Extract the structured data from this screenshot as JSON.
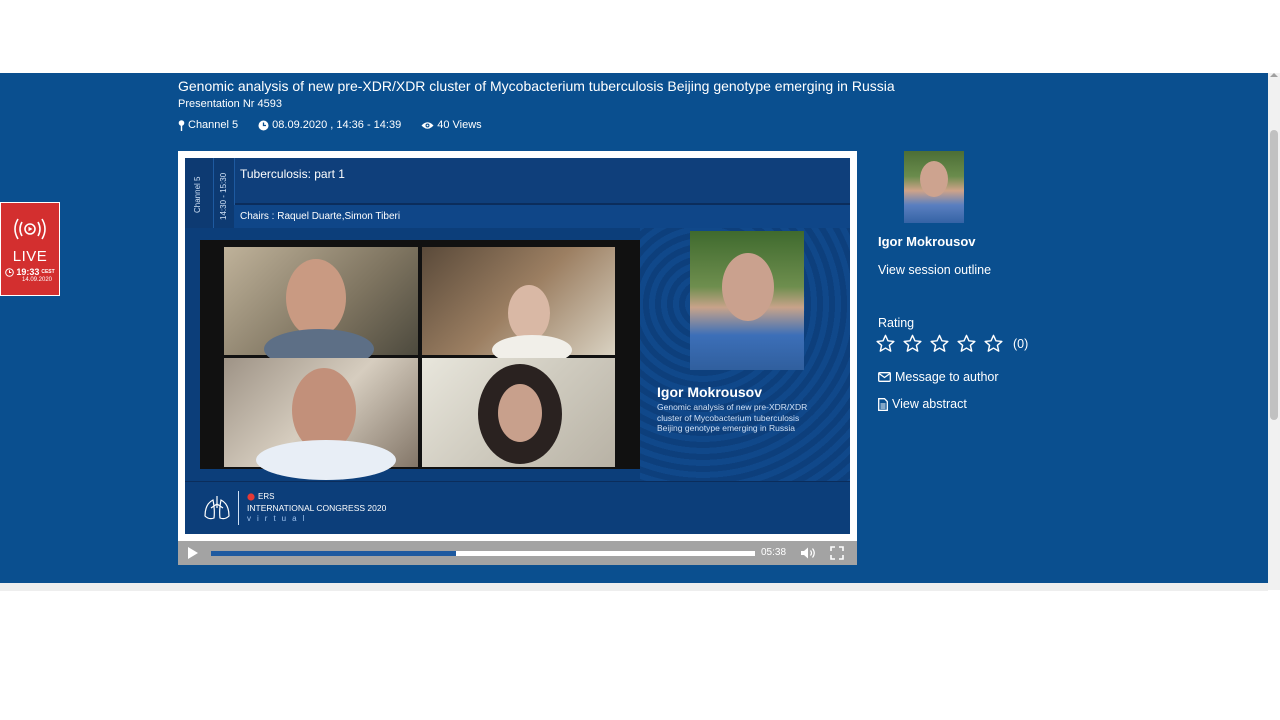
{
  "header": {
    "title": "Genomic analysis of new pre-XDR/XDR cluster of Mycobacterium tuberculosis Beijing genotype emerging in Russia",
    "subtitle": "Presentation Nr 4593",
    "channel": "Channel 5",
    "datetime": "08.09.2020 , 14:36 - 14:39",
    "views": "40 Views"
  },
  "live_widget": {
    "label": "LIVE",
    "time": "19:33",
    "timezone": "CEST",
    "date": "14.09.2020",
    "accent": "#d32f2f"
  },
  "slide": {
    "channel": "Channel 5",
    "time_range": "14:30 - 15:30",
    "session": "Tuberculosis: part 1",
    "chairs": "Chairs : Raquel Duarte,Simon Tiberi",
    "speaker_name": "Igor Mokrousov",
    "speaker_desc": "Genomic analysis of new pre-XDR/XDR cluster of Mycobacterium tuberculosis Beijing genotype emerging in Russia",
    "ers_label": "ERS",
    "congress": "INTERNATIONAL CONGRESS 2020",
    "virtual": "virtual"
  },
  "player": {
    "current_time": "05:38",
    "progress": 0.45
  },
  "sidebar": {
    "author_name": "Igor Mokrousov",
    "outline_link": "View session outline",
    "rating_label": "Rating",
    "rating_stars": 5,
    "rating_count": "(0)",
    "message_link": "Message to author",
    "abstract_link": "View abstract"
  },
  "colors": {
    "band": "#0a4f8f",
    "progress": "#1e5aa0"
  }
}
